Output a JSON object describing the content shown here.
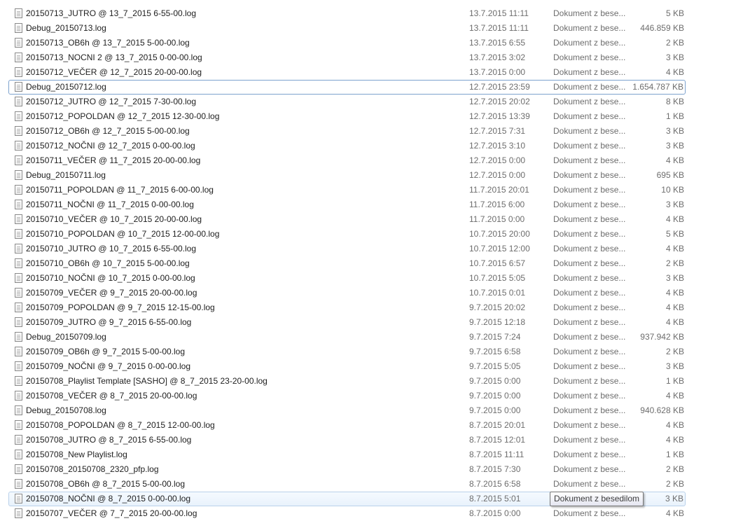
{
  "files": [
    {
      "name": "20150713_JUTRO @ 13_7_2015 6-55-00.log",
      "date": "13.7.2015 11:11",
      "type": "Dokument z bese...",
      "size": "5 KB"
    },
    {
      "name": "Debug_20150713.log",
      "date": "13.7.2015 11:11",
      "type": "Dokument z bese...",
      "size": "446.859 KB"
    },
    {
      "name": "20150713_OB6h @ 13_7_2015 5-00-00.log",
      "date": "13.7.2015 6:55",
      "type": "Dokument z bese...",
      "size": "2 KB"
    },
    {
      "name": "20150713_NOCNI 2 @ 13_7_2015 0-00-00.log",
      "date": "13.7.2015 3:02",
      "type": "Dokument z bese...",
      "size": "3 KB"
    },
    {
      "name": "20150712_VEČER @ 12_7_2015 20-00-00.log",
      "date": "13.7.2015 0:00",
      "type": "Dokument z bese...",
      "size": "4 KB"
    },
    {
      "name": "Debug_20150712.log",
      "date": "12.7.2015 23:59",
      "type": "Dokument z bese...",
      "size": "1.654.787 KB"
    },
    {
      "name": "20150712_JUTRO @ 12_7_2015 7-30-00.log",
      "date": "12.7.2015 20:02",
      "type": "Dokument z bese...",
      "size": "8 KB"
    },
    {
      "name": "20150712_POPOLDAN @ 12_7_2015 12-30-00.log",
      "date": "12.7.2015 13:39",
      "type": "Dokument z bese...",
      "size": "1 KB"
    },
    {
      "name": "20150712_OB6h @ 12_7_2015 5-00-00.log",
      "date": "12.7.2015 7:31",
      "type": "Dokument z bese...",
      "size": "3 KB"
    },
    {
      "name": "20150712_NOČNI @ 12_7_2015 0-00-00.log",
      "date": "12.7.2015 3:10",
      "type": "Dokument z bese...",
      "size": "3 KB"
    },
    {
      "name": "20150711_VEČER @ 11_7_2015 20-00-00.log",
      "date": "12.7.2015 0:00",
      "type": "Dokument z bese...",
      "size": "4 KB"
    },
    {
      "name": "Debug_20150711.log",
      "date": "12.7.2015 0:00",
      "type": "Dokument z bese...",
      "size": "695 KB"
    },
    {
      "name": "20150711_POPOLDAN @ 11_7_2015 6-00-00.log",
      "date": "11.7.2015 20:01",
      "type": "Dokument z bese...",
      "size": "10 KB"
    },
    {
      "name": "20150711_NOČNI @ 11_7_2015 0-00-00.log",
      "date": "11.7.2015 6:00",
      "type": "Dokument z bese...",
      "size": "3 KB"
    },
    {
      "name": "20150710_VEČER @ 10_7_2015 20-00-00.log",
      "date": "11.7.2015 0:00",
      "type": "Dokument z bese...",
      "size": "4 KB"
    },
    {
      "name": "20150710_POPOLDAN @ 10_7_2015 12-00-00.log",
      "date": "10.7.2015 20:00",
      "type": "Dokument z bese...",
      "size": "5 KB"
    },
    {
      "name": "20150710_JUTRO @ 10_7_2015 6-55-00.log",
      "date": "10.7.2015 12:00",
      "type": "Dokument z bese...",
      "size": "4 KB"
    },
    {
      "name": "20150710_OB6h @ 10_7_2015 5-00-00.log",
      "date": "10.7.2015 6:57",
      "type": "Dokument z bese...",
      "size": "2 KB"
    },
    {
      "name": "20150710_NOČNI @ 10_7_2015 0-00-00.log",
      "date": "10.7.2015 5:05",
      "type": "Dokument z bese...",
      "size": "3 KB"
    },
    {
      "name": "20150709_VEČER @ 9_7_2015 20-00-00.log",
      "date": "10.7.2015 0:01",
      "type": "Dokument z bese...",
      "size": "4 KB"
    },
    {
      "name": "20150709_POPOLDAN @ 9_7_2015 12-15-00.log",
      "date": "9.7.2015 20:02",
      "type": "Dokument z bese...",
      "size": "4 KB"
    },
    {
      "name": "20150709_JUTRO @ 9_7_2015 6-55-00.log",
      "date": "9.7.2015 12:18",
      "type": "Dokument z bese...",
      "size": "4 KB"
    },
    {
      "name": "Debug_20150709.log",
      "date": "9.7.2015 7:24",
      "type": "Dokument z bese...",
      "size": "937.942 KB"
    },
    {
      "name": "20150709_OB6h @ 9_7_2015 5-00-00.log",
      "date": "9.7.2015 6:58",
      "type": "Dokument z bese...",
      "size": "2 KB"
    },
    {
      "name": "20150709_NOČNI @ 9_7_2015 0-00-00.log",
      "date": "9.7.2015 5:05",
      "type": "Dokument z bese...",
      "size": "3 KB"
    },
    {
      "name": "20150708_Playlist Template [SASHO] @ 8_7_2015 23-20-00.log",
      "date": "9.7.2015 0:00",
      "type": "Dokument z bese...",
      "size": "1 KB"
    },
    {
      "name": "20150708_VEČER @ 8_7_2015 20-00-00.log",
      "date": "9.7.2015 0:00",
      "type": "Dokument z bese...",
      "size": "4 KB"
    },
    {
      "name": "Debug_20150708.log",
      "date": "9.7.2015 0:00",
      "type": "Dokument z bese...",
      "size": "940.628 KB"
    },
    {
      "name": "20150708_POPOLDAN @ 8_7_2015 12-00-00.log",
      "date": "8.7.2015 20:01",
      "type": "Dokument z bese...",
      "size": "4 KB"
    },
    {
      "name": "20150708_JUTRO @ 8_7_2015 6-55-00.log",
      "date": "8.7.2015 12:01",
      "type": "Dokument z bese...",
      "size": "4 KB"
    },
    {
      "name": "20150708_New Playlist.log",
      "date": "8.7.2015 11:11",
      "type": "Dokument z bese...",
      "size": "1 KB"
    },
    {
      "name": "20150708_20150708_2320_pfp.log",
      "date": "8.7.2015 7:30",
      "type": "Dokument z bese...",
      "size": "2 KB"
    },
    {
      "name": "20150708_OB6h @ 8_7_2015 5-00-00.log",
      "date": "8.7.2015 6:58",
      "type": "Dokument z bese...",
      "size": "2 KB"
    },
    {
      "name": "20150708_NOČNI @ 8_7_2015 0-00-00.log",
      "date": "8.7.2015 5:01",
      "type": "Dokument z bese...",
      "size": "3 KB"
    },
    {
      "name": "20150707_VEČER @ 7_7_2015 20-00-00.log",
      "date": "8.7.2015 0:00",
      "type": "Dokument z bese...",
      "size": "4 KB"
    }
  ],
  "focused_index": 5,
  "hovered_index": 33,
  "tooltip": {
    "text": "Dokument z besedilom"
  },
  "colors": {
    "focus_border": "#7da2ce",
    "hover_border": "#b9d1ea",
    "secondary_text": "#6d6d6d"
  },
  "icons": {
    "file": "text-document-icon"
  }
}
